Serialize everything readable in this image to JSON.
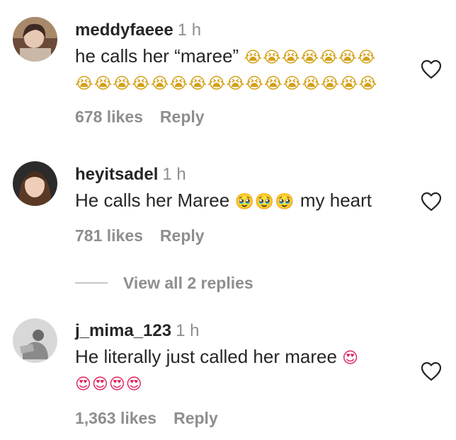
{
  "comments": [
    {
      "username": "meddyfaeee",
      "time": "1 h",
      "text": "he calls her “maree”",
      "emoji_line1": "😭😭😭😭😭😭😭",
      "emoji_line2": "😭😭😭😭😭😭😭😭😭😭😭😭😭😭😭😭",
      "likes": "678 likes",
      "reply": "Reply",
      "avatar_icon": "user-avatar"
    },
    {
      "username": "heyitsadel",
      "time": "1 h",
      "text": "He calls her Maree",
      "emoji_inline": "🥹🥹🥹",
      "text_after": "my heart",
      "likes": "781 likes",
      "reply": "Reply",
      "avatar_icon": "user-avatar"
    },
    {
      "username": "j_mima_123",
      "time": "1 h",
      "text": "He literally just called her maree",
      "emoji_inline": "😍",
      "emoji_line2": "😍😍😍😍",
      "likes": "1,363 likes",
      "reply": "Reply",
      "avatar_icon": "user-avatar"
    }
  ],
  "view_replies": "View all 2 replies",
  "icons": {
    "like": "heart-outline-icon"
  },
  "colors": {
    "text": "#262626",
    "secondary": "#8e8e8e"
  }
}
